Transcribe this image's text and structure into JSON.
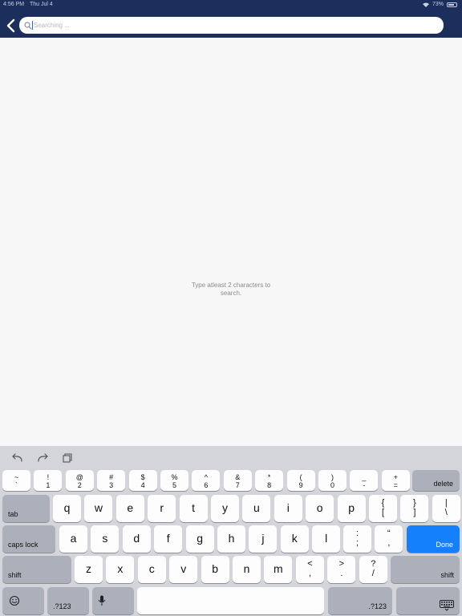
{
  "status_bar": {
    "time": "4:56 PM",
    "date": "Thu Jul 4",
    "battery": "73%"
  },
  "search": {
    "placeholder": "Searching ...",
    "value": ""
  },
  "empty_state": {
    "line1": "Type atleast 2 characters to",
    "line2": "search."
  },
  "keyboard": {
    "row_numbers": [
      {
        "top": "~",
        "bot": "`"
      },
      {
        "top": "!",
        "bot": "1"
      },
      {
        "top": "@",
        "bot": "2"
      },
      {
        "top": "#",
        "bot": "3"
      },
      {
        "top": "$",
        "bot": "4"
      },
      {
        "top": "%",
        "bot": "5"
      },
      {
        "top": "^",
        "bot": "6"
      },
      {
        "top": "&",
        "bot": "7"
      },
      {
        "top": "*",
        "bot": "8"
      },
      {
        "top": "(",
        "bot": "9"
      },
      {
        "top": ")",
        "bot": "0"
      },
      {
        "top": "_",
        "bot": "-"
      },
      {
        "top": "+",
        "bot": "="
      }
    ],
    "delete": "delete",
    "tab": "tab",
    "row_q": [
      "q",
      "w",
      "e",
      "r",
      "t",
      "y",
      "u",
      "i",
      "o",
      "p"
    ],
    "row_q_symbols": [
      {
        "top": "{",
        "bot": "["
      },
      {
        "top": "}",
        "bot": "]"
      },
      {
        "top": "|",
        "bot": "\\"
      }
    ],
    "caps_lock": "caps lock",
    "row_a": [
      "a",
      "s",
      "d",
      "f",
      "g",
      "h",
      "j",
      "k",
      "l"
    ],
    "row_a_symbols": [
      {
        "top": ":",
        "bot": ";"
      },
      {
        "top": "“",
        "bot": ","
      }
    ],
    "done": "Done",
    "shift_left": "shift",
    "row_z": [
      "z",
      "x",
      "c",
      "v",
      "b",
      "n",
      "m"
    ],
    "row_z_symbols": [
      {
        "top": "<",
        "bot": ","
      },
      {
        "top": ">",
        "bot": "."
      },
      {
        "top": "?",
        "bot": "/"
      }
    ],
    "shift_right": "shift",
    "numbers_left": ".?123",
    "numbers_right": ".?123"
  }
}
